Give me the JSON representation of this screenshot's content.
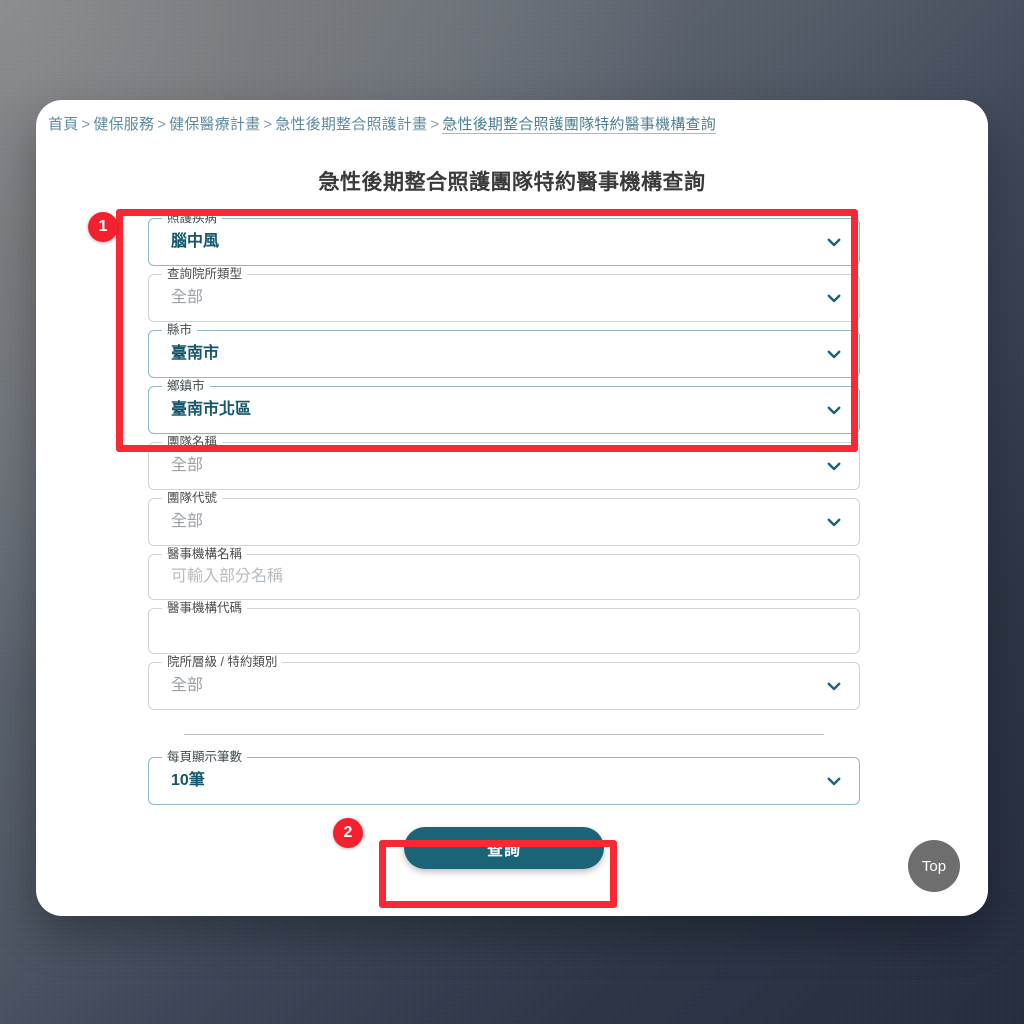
{
  "window": {
    "background_top_left": "#8d8f92",
    "background_bottom_right": "#232c3e"
  },
  "breadcrumb": {
    "separator": ">",
    "items": [
      {
        "label": "首頁",
        "current": false
      },
      {
        "label": "健保服務",
        "current": false
      },
      {
        "label": "健保醫療計畫",
        "current": false
      },
      {
        "label": "急性後期整合照護計畫",
        "current": false
      },
      {
        "label": "急性後期整合照護團隊特約醫事機構查詢",
        "current": true
      }
    ]
  },
  "page": {
    "title": "急性後期整合照護團隊特約醫事機構查詢"
  },
  "form": {
    "fields": [
      {
        "name": "care-disease",
        "label": "照護疾病",
        "value": "腦中風",
        "state": "selected",
        "control": "select",
        "highlighted": true
      },
      {
        "name": "facility-type",
        "label": "查詢院所類型",
        "value": "全部",
        "state": "default",
        "control": "select",
        "highlighted": true
      },
      {
        "name": "county",
        "label": "縣市",
        "value": "臺南市",
        "state": "selected",
        "control": "select",
        "highlighted": true
      },
      {
        "name": "township",
        "label": "鄉鎮市",
        "value": "臺南市北區",
        "state": "selected",
        "control": "select",
        "highlighted": true
      },
      {
        "name": "team-name",
        "label": "團隊名稱",
        "value": "全部",
        "state": "default",
        "control": "select",
        "highlighted": false
      },
      {
        "name": "team-code",
        "label": "團隊代號",
        "value": "全部",
        "state": "default",
        "control": "select",
        "highlighted": false
      },
      {
        "name": "institution-name",
        "label": "醫事機構名稱",
        "value": "",
        "placeholder": "可輸入部分名稱",
        "state": "placeholder",
        "control": "text",
        "highlighted": false
      },
      {
        "name": "institution-code",
        "label": "醫事機構代碼",
        "value": "",
        "placeholder": "",
        "state": "empty",
        "control": "text",
        "highlighted": false
      },
      {
        "name": "institution-level",
        "label": "院所層級 / 特約類別",
        "value": "全部",
        "state": "default",
        "control": "select",
        "highlighted": false
      }
    ],
    "page_size": {
      "name": "page-size",
      "label": "每頁顯示筆數",
      "value": "10筆",
      "state": "selected",
      "control": "select"
    },
    "submit": {
      "label": "查詢",
      "color": "#1b6477"
    }
  },
  "float": {
    "top_button_label": "Top",
    "top_button_color": "#6e6e6e"
  },
  "annotations": {
    "color": "#fa2833",
    "badges": [
      {
        "id": "badge-1",
        "label": "1"
      },
      {
        "id": "badge-2",
        "label": "2"
      }
    ],
    "boxes": [
      {
        "id": "hl-1",
        "target": "care-disease..township group"
      },
      {
        "id": "hl-2",
        "target": "submit button"
      }
    ]
  },
  "icons": {
    "chevron_down": "chevron-down-icon",
    "chevron_color": "#1b6477"
  }
}
